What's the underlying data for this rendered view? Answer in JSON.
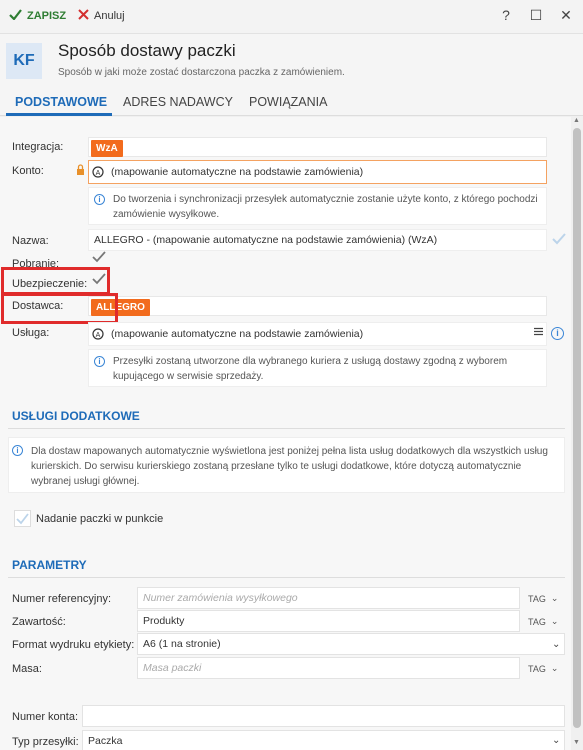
{
  "toolbar": {
    "save_label": "ZAPISZ",
    "cancel_label": "Anuluj"
  },
  "window": {
    "help": "?",
    "maximize": "☐",
    "close": "✕"
  },
  "header": {
    "badge": "KF",
    "title": "Sposób dostawy paczki",
    "subtitle": "Sposób w jaki może zostać dostarczona paczka z zamówieniem."
  },
  "tabs": [
    {
      "label": "PODSTAWOWE"
    },
    {
      "label": "ADRES NADAWCY"
    },
    {
      "label": "POWIĄZANIA"
    }
  ],
  "form": {
    "integracja": {
      "label": "Integracja:",
      "badge": "WzA"
    },
    "konto": {
      "label": "Konto:",
      "value": "(mapowanie automatyczne na podstawie zamówienia)",
      "note": "Do tworzenia i synchronizacji przesyłek automatycznie zostanie użyte konto, z którego pochodzi zamówienie wysyłkowe."
    },
    "nazwa": {
      "label": "Nazwa:",
      "value": "ALLEGRO - (mapowanie automatyczne na podstawie zamówienia) (WzA)"
    },
    "pobranie": {
      "label": "Pobranie:"
    },
    "ubezpieczenie": {
      "label": "Ubezpieczenie:"
    },
    "dostawca": {
      "label": "Dostawca:",
      "badge": "ALLEGRO"
    },
    "usluga": {
      "label": "Usługa:",
      "value": "(mapowanie automatyczne na podstawie zamówienia)",
      "note": "Przesyłki zostaną utworzone dla wybranego kuriera z usługą dostawy zgodną z wyborem kupującego w serwisie sprzedaży."
    }
  },
  "uslugi": {
    "title": "USŁUGI DODATKOWE",
    "note": "Dla dostaw mapowanych automatycznie wyświetlona jest poniżej pełna lista usług dodatkowych dla wszystkich usług kurierskich. Do serwisu kurierskiego zostaną przesłane tylko te usługi dodatkowe, które dotyczą automatycznie wybranej usługi głównej.",
    "nadanie": "Nadanie paczki w punkcie"
  },
  "parametry": {
    "title": "PARAMETRY",
    "numer_ref": {
      "label": "Numer referencyjny:",
      "placeholder": "Numer zamówienia wysyłkowego",
      "tag": "TAG"
    },
    "zawartosc": {
      "label": "Zawartość:",
      "value": "Produkty",
      "tag": "TAG"
    },
    "format": {
      "label": "Format wydruku etykiety:",
      "value": "A6 (1 na stronie)"
    },
    "masa": {
      "label": "Masa:",
      "placeholder": "Masa paczki",
      "tag": "TAG"
    },
    "numer_konta": {
      "label": "Numer konta:"
    },
    "typ": {
      "label": "Typ przesyłki:",
      "value": "Paczka"
    }
  },
  "colors": {
    "accent": "#1e6bb8",
    "badge": "#f26b1d",
    "highlight": "#e02b2b"
  }
}
